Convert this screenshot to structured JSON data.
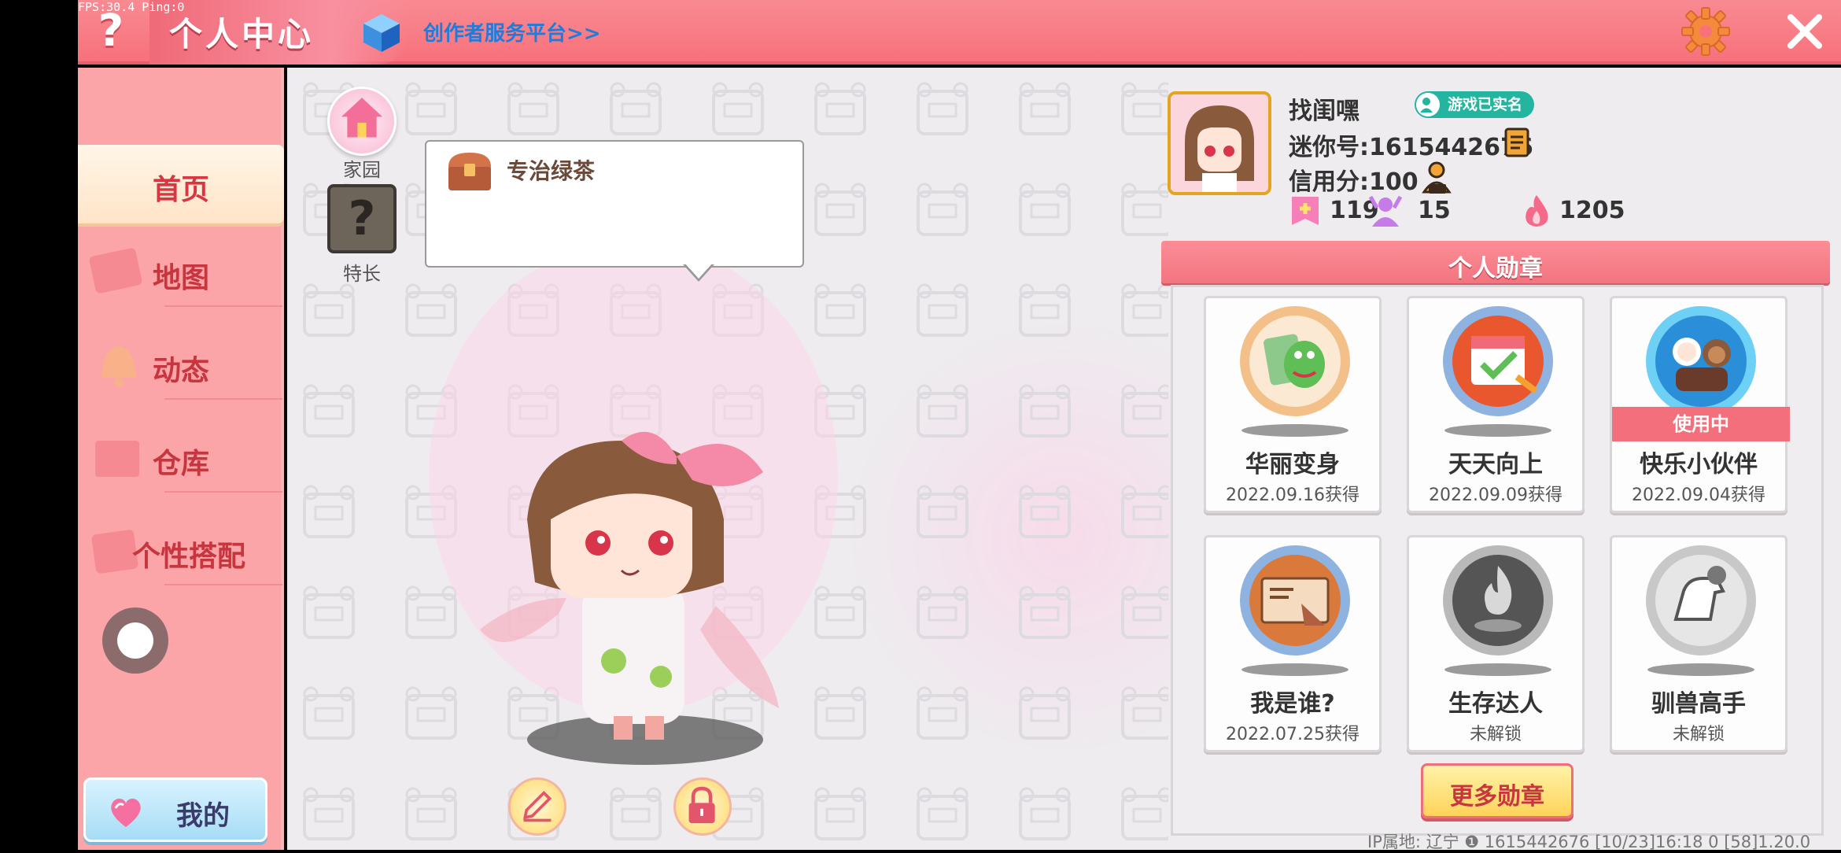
{
  "debug": {
    "fps": "FPS:30.4  Ping:0"
  },
  "header": {
    "title": "个人中心",
    "creator_link": "创作者服务平台>>"
  },
  "sidebar": {
    "items": [
      {
        "label": "首页",
        "active": true
      },
      {
        "label": "地图",
        "active": false
      },
      {
        "label": "动态",
        "active": false
      },
      {
        "label": "仓库",
        "active": false
      },
      {
        "label": "个性搭配",
        "active": false
      }
    ],
    "mine_button": "我的"
  },
  "quick": {
    "home_label": "家园",
    "skill_label": "特长",
    "skill_glyph": "?"
  },
  "bubble": {
    "text": "专治绿茶"
  },
  "profile": {
    "nickname": "找闺嘿",
    "verified_badge": "游戏已实名",
    "mini_id": "迷你号:1615442676",
    "credit": "信用分:100",
    "stats": [
      {
        "icon": "likes-icon",
        "value": "119"
      },
      {
        "icon": "fans-icon",
        "value": "15"
      },
      {
        "icon": "popularity-icon",
        "value": "1205"
      }
    ]
  },
  "medals": {
    "title": "个人勋章",
    "items": [
      {
        "name": "华丽变身",
        "date": "2022.09.16获得",
        "in_use": false,
        "locked": false,
        "icon": "dinosaur-medal-icon",
        "color": "#f0a060"
      },
      {
        "name": "天天向上",
        "date": "2022.09.09获得",
        "in_use": false,
        "locked": false,
        "icon": "calendar-medal-icon",
        "color": "#6f9bd4"
      },
      {
        "name": "快乐小伙伴",
        "date": "2022.09.04获得",
        "in_use": true,
        "in_use_label": "使用中",
        "locked": false,
        "icon": "friends-medal-icon",
        "color": "#4fb6e9"
      },
      {
        "name": "我是谁?",
        "date": "2022.07.25获得",
        "in_use": false,
        "locked": false,
        "icon": "letter-medal-icon",
        "color": "#6f9bd4"
      },
      {
        "name": "生存达人",
        "date": "未解锁",
        "in_use": false,
        "locked": true,
        "icon": "campfire-medal-icon",
        "color": "#9a9a9a"
      },
      {
        "name": "驯兽高手",
        "date": "未解锁",
        "in_use": false,
        "locked": true,
        "icon": "horse-medal-icon",
        "color": "#b0b0b0"
      }
    ],
    "more_button": "更多勋章"
  },
  "footer": {
    "text": "IP属地: 辽宁 ❶     1615442676     [10/23]16:18 0  [58]1.20.0"
  }
}
